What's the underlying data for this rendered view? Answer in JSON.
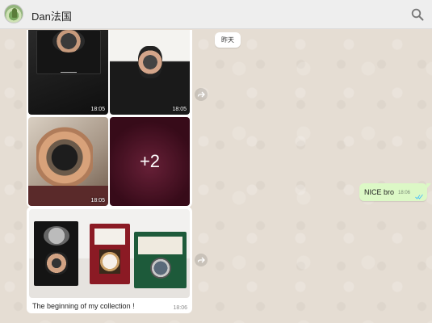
{
  "header": {
    "contact_name": "Dan法国",
    "avatar_icon": "avatar-image",
    "search_icon": "search-icon"
  },
  "date_chip": {
    "label": "昨天"
  },
  "album": {
    "items": [
      {
        "time": "18:05"
      },
      {
        "time": "18:05"
      },
      {
        "time": "18:05"
      },
      {
        "more_label": "+2"
      }
    ]
  },
  "outgoing": {
    "text": "NICE  bro",
    "time": "18:06",
    "status_icon": "double-check-icon",
    "status_color": "#4fc3f7"
  },
  "photo_message": {
    "caption": "The beginning of my collection !",
    "time": "18:06"
  },
  "colors": {
    "header_bg": "#eeeeee",
    "outgoing_bubble": "#dcf8c6",
    "chat_bg": "#e5ddd3"
  }
}
